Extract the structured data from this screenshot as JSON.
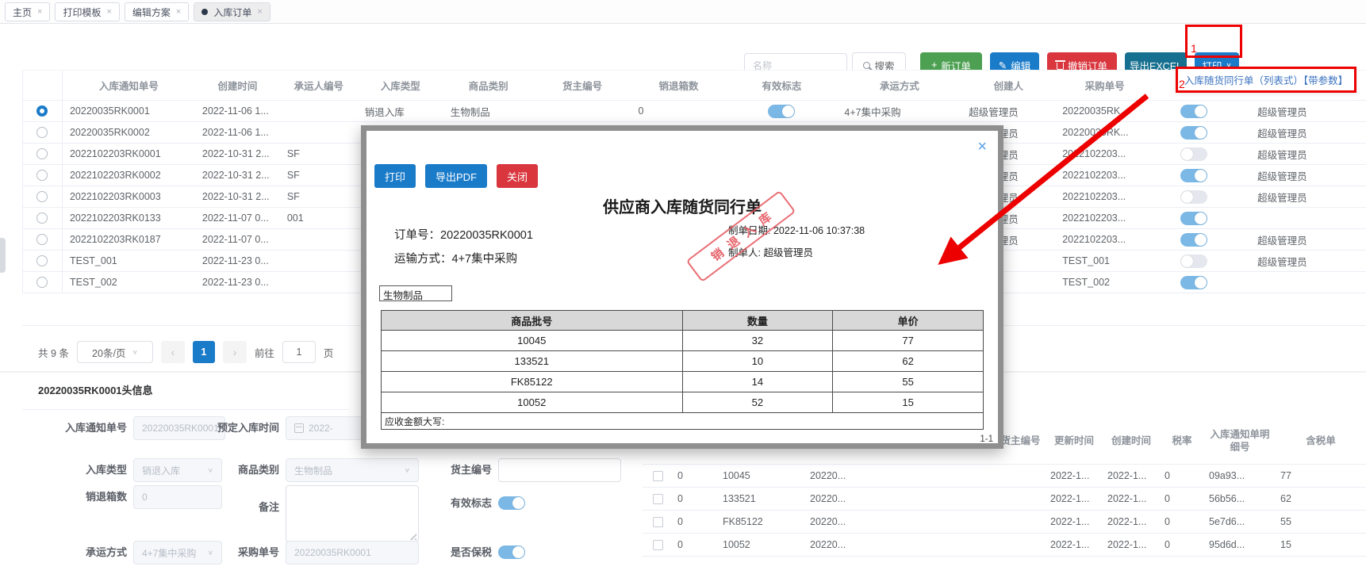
{
  "icons": {
    "close": "×",
    "caret": "∨",
    "prev": "‹",
    "next": "›",
    "plus": "+",
    "edit": "✎"
  },
  "tabs": [
    {
      "label": "主页",
      "active": false
    },
    {
      "label": "打印模板",
      "active": false
    },
    {
      "label": "编辑方案",
      "active": false
    },
    {
      "label": "入库订单",
      "active": true
    }
  ],
  "toolbar": {
    "search_placeholder": "名称",
    "search_label": "搜索",
    "new_order": "新订单",
    "edit": "编辑",
    "cancel_order": "撤销订单",
    "export_excel": "导出EXCEL",
    "print": "打印"
  },
  "annotations": {
    "marker1": "1",
    "marker2": "2",
    "dropdown_item": "入库随货同行单（列表式）【带参数】"
  },
  "orders": {
    "headers": [
      "入库通知单号",
      "创建时间",
      "承运人编号",
      "入库类型",
      "商品类别",
      "货主编号",
      "销退箱数",
      "有效标志",
      "承运方式",
      "创建人",
      "采购单号"
    ],
    "rows": [
      {
        "selected": true,
        "notice_no": "20220035RK0001",
        "created": "2022-11-06 1...",
        "carrier": "",
        "type": "销退入库",
        "category": "生物制品",
        "owner": "",
        "return_boxes": "0",
        "valid": true,
        "transport": "4+7集中采购",
        "creator": "超级管理员",
        "po": "20220035RK...",
        "flag": true,
        "updater": "超级管理员"
      },
      {
        "selected": false,
        "notice_no": "20220035RK0002",
        "created": "2022-11-06 1...",
        "carrier": "",
        "type": "",
        "category": "",
        "owner": "",
        "return_boxes": "",
        "valid": true,
        "transport": "",
        "creator": "超级管理员",
        "po": "20220035RK...",
        "flag": true,
        "updater": "超级管理员"
      },
      {
        "selected": false,
        "notice_no": "2022102203RK0001",
        "created": "2022-10-31 2...",
        "carrier": "SF",
        "type": "",
        "category": "",
        "owner": "",
        "return_boxes": "",
        "valid": false,
        "transport": "",
        "creator": "超级管理员",
        "po": "2022102203...",
        "flag": false,
        "updater": "超级管理员"
      },
      {
        "selected": false,
        "notice_no": "2022102203RK0002",
        "created": "2022-10-31 2...",
        "carrier": "SF",
        "type": "",
        "category": "",
        "owner": "",
        "return_boxes": "",
        "valid": false,
        "transport": "",
        "creator": "超级管理员",
        "po": "2022102203...",
        "flag": true,
        "updater": "超级管理员"
      },
      {
        "selected": false,
        "notice_no": "2022102203RK0003",
        "created": "2022-10-31 2...",
        "carrier": "SF",
        "type": "",
        "category": "",
        "owner": "",
        "return_boxes": "",
        "valid": false,
        "transport": "",
        "creator": "超级管理员",
        "po": "2022102203...",
        "flag": false,
        "updater": "超级管理员"
      },
      {
        "selected": false,
        "notice_no": "2022102203RK0133",
        "created": "2022-11-07 0...",
        "carrier": "001",
        "type": "",
        "category": "",
        "owner": "",
        "return_boxes": "",
        "valid": false,
        "transport": "",
        "creator": "超级管理员",
        "po": "2022102203...",
        "flag": true,
        "updater": ""
      },
      {
        "selected": false,
        "notice_no": "2022102203RK0187",
        "created": "2022-11-07 0...",
        "carrier": "",
        "type": "",
        "category": "",
        "owner": "",
        "return_boxes": "",
        "valid": false,
        "transport": "",
        "creator": "超级管理员",
        "po": "2022102203...",
        "flag": true,
        "updater": "超级管理员"
      },
      {
        "selected": false,
        "notice_no": "TEST_001",
        "created": "2022-11-23 0...",
        "carrier": "",
        "type": "",
        "category": "",
        "owner": "",
        "return_boxes": "",
        "valid": false,
        "transport": "",
        "creator": "",
        "po": "TEST_001",
        "flag": false,
        "updater": "超级管理员"
      },
      {
        "selected": false,
        "notice_no": "TEST_002",
        "created": "2022-11-23 0...",
        "carrier": "",
        "type": "",
        "category": "",
        "owner": "",
        "return_boxes": "",
        "valid": false,
        "transport": "",
        "creator": "",
        "po": "TEST_002",
        "flag": true,
        "updater": ""
      }
    ]
  },
  "pagination": {
    "total": "共 9 条",
    "page_size": "20条/页",
    "current": "1",
    "goto_label": "前往",
    "goto_value": "1",
    "page_label": "页"
  },
  "modal": {
    "print": "打印",
    "export_pdf": "导出PDF",
    "close": "关闭",
    "title": "供应商入库随货同行单",
    "order_no_label": "订单号：",
    "order_no": "20220035RK0001",
    "transport_label": "运输方式：",
    "transport": "4+7集中采购",
    "date_label": "制单日期:",
    "date": "2022-11-06 10:37:38",
    "maker_label": "制单人:",
    "maker": "超级管理员",
    "category": "生物制品",
    "stamp": "销退入库",
    "table": {
      "headers": [
        "商品批号",
        "数量",
        "单价"
      ],
      "rows": [
        [
          "10045",
          "32",
          "77"
        ],
        [
          "133521",
          "10",
          "62"
        ],
        [
          "FK85122",
          "14",
          "55"
        ],
        [
          "10052",
          "52",
          "15"
        ]
      ],
      "footer": "应收金额大写:"
    },
    "page_indicator": "1-1"
  },
  "form": {
    "section_title": "20220035RK0001头信息",
    "notice_label": "入库通知单号",
    "notice_value": "20220035RK0001",
    "planned_label": "预定入库时间",
    "planned_value": "2022-",
    "type_label": "入库类型",
    "type_value": "销退入库",
    "category_label": "商品类别",
    "category_value": "生物制品",
    "owner_label": "货主编号",
    "owner_value": "",
    "boxes_label": "销退箱数",
    "boxes_value": "0",
    "remark_label": "备注",
    "remark_value": "",
    "valid_label": "有效标志",
    "transport_label": "承运方式",
    "transport_value": "4+7集中采购",
    "po_label": "采购单号",
    "po_value": "20220035RK0001",
    "bonded_label": "是否保税"
  },
  "details": {
    "headers": [
      "",
      "",
      "",
      "",
      "货主编号",
      "更新时间",
      "创建时间",
      "税率",
      "入库通知单明细号",
      "含税单"
    ],
    "rows": [
      {
        "c1": "0",
        "c2": "10045",
        "c3": "20220...",
        "c4": "",
        "c5": "",
        "c6": "2022-1...",
        "c7": "2022-1...",
        "c8": "0",
        "c9": "09a93...",
        "c10": "77"
      },
      {
        "c1": "0",
        "c2": "133521",
        "c3": "20220...",
        "c4": "",
        "c5": "",
        "c6": "2022-1...",
        "c7": "2022-1...",
        "c8": "0",
        "c9": "56b56...",
        "c10": "62"
      },
      {
        "c1": "0",
        "c2": "FK85122",
        "c3": "20220...",
        "c4": "",
        "c5": "",
        "c6": "2022-1...",
        "c7": "2022-1...",
        "c8": "0",
        "c9": "5e7d6...",
        "c10": "55"
      },
      {
        "c1": "0",
        "c2": "10052",
        "c3": "20220...",
        "c4": "",
        "c5": "",
        "c6": "2022-1...",
        "c7": "2022-1...",
        "c8": "0",
        "c9": "95d6d...",
        "c10": "15"
      }
    ]
  }
}
